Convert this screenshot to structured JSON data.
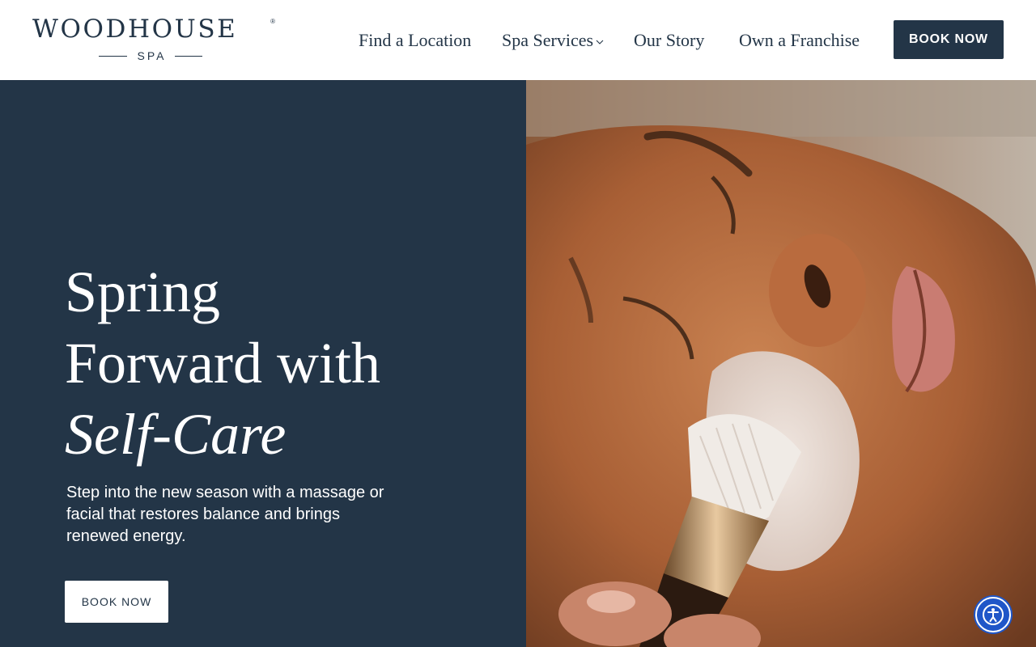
{
  "brand": {
    "name": "WOODHOUSE",
    "subtitle": "SPA",
    "registered": "®"
  },
  "nav": {
    "items": [
      {
        "label": "Find a Location"
      },
      {
        "label": "Spa Services"
      },
      {
        "label": "Our Story"
      },
      {
        "label": "Own a Franchise"
      }
    ],
    "cta": "BOOK NOW"
  },
  "hero": {
    "title_line1": "Spring",
    "title_line2": "Forward with",
    "title_line3": "Self-Care",
    "description": "Step into the new season with a massage or facial that restores balance and brings renewed energy.",
    "cta": "BOOK NOW"
  },
  "icons": {
    "services_dropdown": "chevron-down-icon",
    "accessibility": "accessibility-icon"
  },
  "colors": {
    "brand_navy": "#233547",
    "white": "#ffffff",
    "accessibility_blue": "#1f56c8"
  }
}
